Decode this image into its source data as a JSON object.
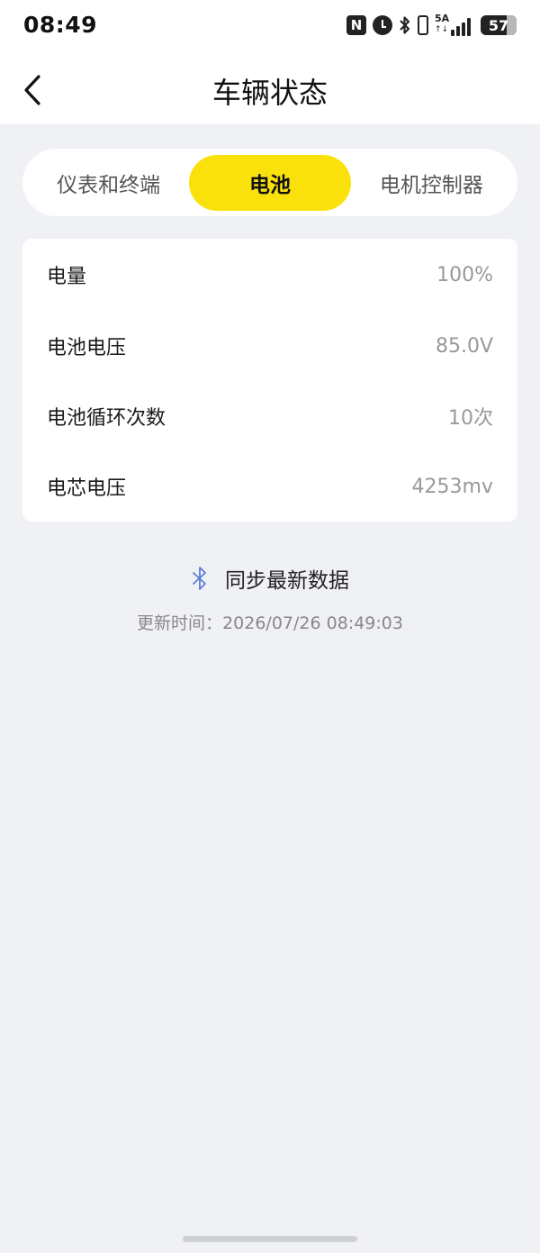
{
  "status_bar": {
    "time": "08:49",
    "nfc_glyph": "N",
    "network_type": "5A",
    "data_arrows": "↑↓",
    "battery_level": "57",
    "icons": [
      "nfc-icon",
      "alarm-icon",
      "bluetooth-icon",
      "vibrate-icon",
      "signal-icon",
      "battery-icon"
    ]
  },
  "header": {
    "title": "车辆状态",
    "back_icon": "chevron-left-icon"
  },
  "tabs": [
    {
      "label": "仪表和终端",
      "active": false
    },
    {
      "label": "电池",
      "active": true
    },
    {
      "label": "电机控制器",
      "active": false
    }
  ],
  "battery_info": {
    "rows": [
      {
        "label": "电量",
        "value": "100%"
      },
      {
        "label": "电池电压",
        "value": "85.0V"
      },
      {
        "label": "电池循环次数",
        "value": "10次"
      },
      {
        "label": "电芯电压",
        "value": "4253mv"
      }
    ]
  },
  "sync": {
    "label": "同步最新数据",
    "icon": "bluetooth-icon",
    "update_prefix": "更新时间：",
    "update_time": "2026/07/26 08:49:03"
  },
  "colors": {
    "accent": "#fbe10c",
    "background": "#f0f1f5",
    "bluetooth_icon": "#5a7fd6"
  }
}
